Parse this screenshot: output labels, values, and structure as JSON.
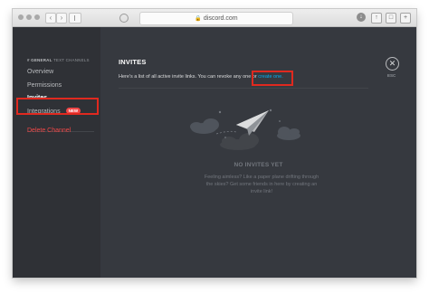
{
  "browser": {
    "address": "discord.com"
  },
  "sidebar": {
    "header_channel": "# GENERAL",
    "header_suffix": "TEXT CHANNELS",
    "items": [
      {
        "label": "Overview"
      },
      {
        "label": "Permissions"
      },
      {
        "label": "Invites"
      },
      {
        "label": "Integrations",
        "badge": "NEW"
      }
    ],
    "delete_label": "Delete Channel"
  },
  "main": {
    "title": "INVITES",
    "description": "Here's a list of all active invite links. You can revoke any one or ",
    "description_link": "create one.",
    "close_label": "ESC",
    "empty_title": "NO INVITES YET",
    "empty_body": "Feeling aimless? Like a paper plane drifting through the skies? Get some friends in here by creating an invite link!"
  },
  "colors": {
    "accent_link": "#00b0f4",
    "danger": "#f04747",
    "highlight_box": "#e0291f"
  }
}
